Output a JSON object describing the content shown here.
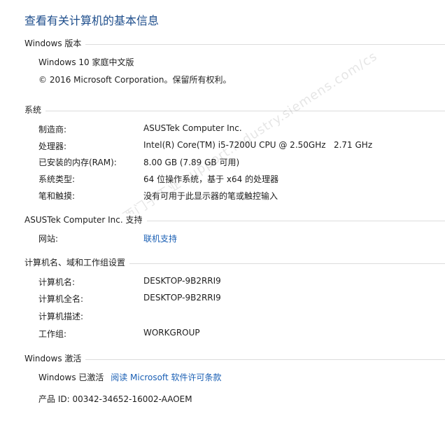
{
  "title": "查看有关计算机的基本信息",
  "windows_edition": {
    "header": "Windows 版本",
    "edition": "Windows 10 家庭中文版",
    "copyright": "© 2016 Microsoft Corporation。保留所有权利。"
  },
  "system": {
    "header": "系统",
    "rows": [
      {
        "label": "制造商:",
        "value": "ASUSTek Computer Inc."
      },
      {
        "label": "处理器:",
        "value": "Intel(R) Core(TM) i5-7200U CPU @ 2.50GHz   2.71 GHz"
      },
      {
        "label": "已安装的内存(RAM):",
        "value": "8.00 GB (7.89 GB 可用)"
      },
      {
        "label": "系统类型:",
        "value": "64 位操作系统，基于 x64 的处理器"
      },
      {
        "label": "笔和触摸:",
        "value": "没有可用于此显示器的笔或触控输入"
      }
    ]
  },
  "support": {
    "header": "ASUSTek Computer Inc. 支持",
    "website_label": "网站:",
    "website_link": "联机支持"
  },
  "computer_name": {
    "header": "计算机名、域和工作组设置",
    "rows": [
      {
        "label": "计算机名:",
        "value": "DESKTOP-9B2RRI9"
      },
      {
        "label": "计算机全名:",
        "value": "DESKTOP-9B2RRI9"
      },
      {
        "label": "计算机描述:",
        "value": ""
      },
      {
        "label": "工作组:",
        "value": "WORKGROUP"
      }
    ]
  },
  "activation": {
    "header": "Windows 激活",
    "status": "Windows 已激活",
    "license_link": "阅读 Microsoft 软件许可条款",
    "product_id": "产品 ID: 00342-34652-16002-AAOEM"
  },
  "watermark": "西门子工业  support.industry.siemens.com/cs"
}
